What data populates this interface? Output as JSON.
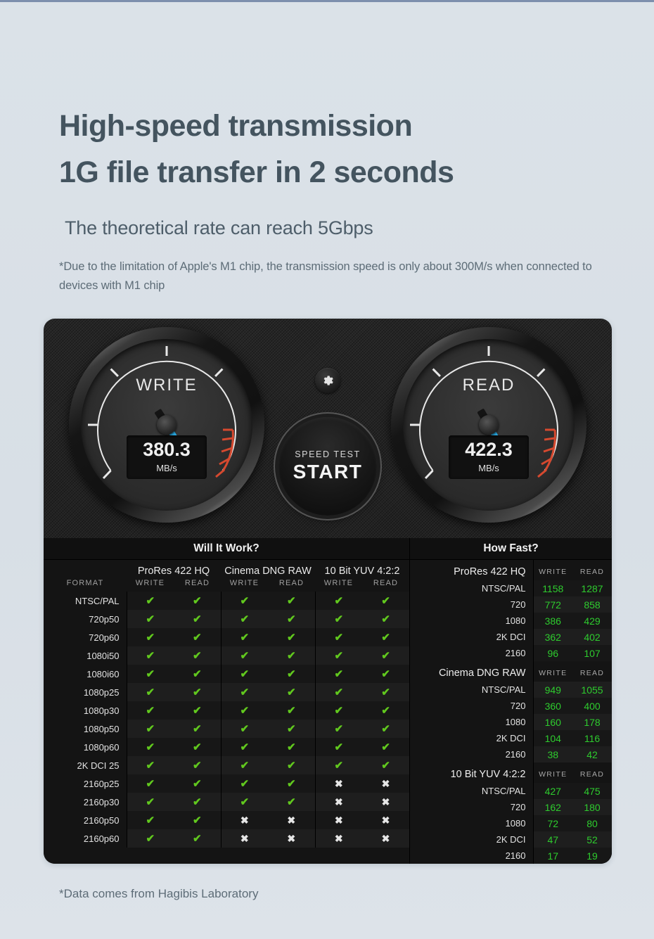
{
  "header": {
    "title_line1": "High-speed transmission",
    "title_line2": "1G file transfer in 2 seconds",
    "subtitle": "The theoretical rate can reach 5Gbps",
    "note": "*Due to the limitation of Apple's M1 chip, the transmission speed is only about 300M/s when connected to devices with M1 chip",
    "title_color": "#44545f"
  },
  "app": {
    "gauges": [
      {
        "label": "WRITE",
        "value": "380.3",
        "unit": "MB/s",
        "needle_deg": 237
      },
      {
        "label": "READ",
        "value": "422.3",
        "unit": "MB/s",
        "needle_deg": 240
      }
    ],
    "gear_icon": "gear-icon",
    "start_button": {
      "top_label": "SPEED TEST",
      "main_label": "START"
    },
    "accent_needle": "#29a8e0",
    "accent_redzone": "#d6492f"
  },
  "will_it_work": {
    "title": "Will It Work?",
    "format_header": "FORMAT",
    "groups": [
      "ProRes 422 HQ",
      "Cinema DNG RAW",
      "10 Bit YUV 4:2:2"
    ],
    "sub_columns": [
      "WRITE",
      "READ"
    ],
    "ok_glyph": "✔",
    "no_glyph": "✖",
    "ok_color": "#61c81e",
    "no_color": "#e6e6e6",
    "rows": [
      {
        "format": "NTSC/PAL",
        "cells": [
          true,
          true,
          true,
          true,
          true,
          true
        ]
      },
      {
        "format": "720p50",
        "cells": [
          true,
          true,
          true,
          true,
          true,
          true
        ]
      },
      {
        "format": "720p60",
        "cells": [
          true,
          true,
          true,
          true,
          true,
          true
        ]
      },
      {
        "format": "1080i50",
        "cells": [
          true,
          true,
          true,
          true,
          true,
          true
        ]
      },
      {
        "format": "1080i60",
        "cells": [
          true,
          true,
          true,
          true,
          true,
          true
        ]
      },
      {
        "format": "1080p25",
        "cells": [
          true,
          true,
          true,
          true,
          true,
          true
        ]
      },
      {
        "format": "1080p30",
        "cells": [
          true,
          true,
          true,
          true,
          true,
          true
        ]
      },
      {
        "format": "1080p50",
        "cells": [
          true,
          true,
          true,
          true,
          true,
          true
        ]
      },
      {
        "format": "1080p60",
        "cells": [
          true,
          true,
          true,
          true,
          true,
          true
        ]
      },
      {
        "format": "2K DCI 25",
        "cells": [
          true,
          true,
          true,
          true,
          true,
          true
        ]
      },
      {
        "format": "2160p25",
        "cells": [
          true,
          true,
          true,
          true,
          false,
          false
        ]
      },
      {
        "format": "2160p30",
        "cells": [
          true,
          true,
          true,
          true,
          false,
          false
        ]
      },
      {
        "format": "2160p50",
        "cells": [
          true,
          true,
          false,
          false,
          false,
          false
        ]
      },
      {
        "format": "2160p60",
        "cells": [
          true,
          true,
          false,
          false,
          false,
          false
        ]
      }
    ]
  },
  "how_fast": {
    "title": "How Fast?",
    "sub_columns": [
      "WRITE",
      "READ"
    ],
    "value_color": "#2ecc2e",
    "sections": [
      {
        "name": "ProRes 422 HQ",
        "rows": [
          {
            "label": "NTSC/PAL",
            "write": "1158",
            "read": "1287"
          },
          {
            "label": "720",
            "write": "772",
            "read": "858"
          },
          {
            "label": "1080",
            "write": "386",
            "read": "429"
          },
          {
            "label": "2K DCI",
            "write": "362",
            "read": "402"
          },
          {
            "label": "2160",
            "write": "96",
            "read": "107"
          }
        ]
      },
      {
        "name": "Cinema DNG RAW",
        "rows": [
          {
            "label": "NTSC/PAL",
            "write": "949",
            "read": "1055"
          },
          {
            "label": "720",
            "write": "360",
            "read": "400"
          },
          {
            "label": "1080",
            "write": "160",
            "read": "178"
          },
          {
            "label": "2K DCI",
            "write": "104",
            "read": "116"
          },
          {
            "label": "2160",
            "write": "38",
            "read": "42"
          }
        ]
      },
      {
        "name": "10 Bit YUV 4:2:2",
        "rows": [
          {
            "label": "NTSC/PAL",
            "write": "427",
            "read": "475"
          },
          {
            "label": "720",
            "write": "162",
            "read": "180"
          },
          {
            "label": "1080",
            "write": "72",
            "read": "80"
          },
          {
            "label": "2K DCI",
            "write": "47",
            "read": "52"
          },
          {
            "label": "2160",
            "write": "17",
            "read": "19"
          }
        ]
      }
    ]
  },
  "footer": {
    "text": "*Data comes from Hagibis Laboratory"
  }
}
